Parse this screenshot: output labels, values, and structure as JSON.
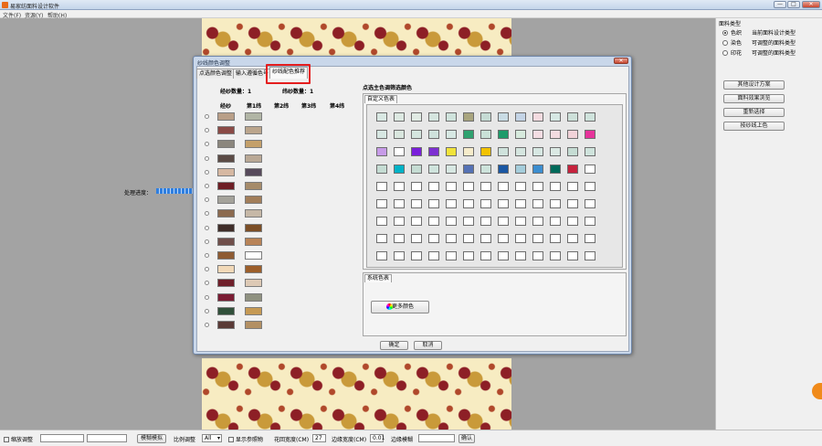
{
  "window": {
    "title": "易家纺面料设计软件",
    "controls": [
      "—",
      "□",
      "✕"
    ]
  },
  "menu": [
    "文件(F)",
    "资源(Y)",
    "帮助(H)"
  ],
  "progress": {
    "label": "处理进度：",
    "fraction": 0.95
  },
  "right_panel": {
    "group_title": "面料类型",
    "options": [
      {
        "name": "色织",
        "desc": "当前面料设计类型",
        "checked": true
      },
      {
        "name": "染色",
        "desc": "可调整的面料类型",
        "checked": false
      },
      {
        "name": "印花",
        "desc": "可调整的面料类型",
        "checked": false
      }
    ],
    "buttons": [
      "其他设计方案",
      "面料效果浏览",
      "重新选择",
      "按纱线上色"
    ]
  },
  "bottom_bar": {
    "zoom_adjust": "缩放调整",
    "blur_button": "模糊模拟",
    "ratio_label": "比例调整",
    "ratio_value": "All",
    "show_ref": "显示参照物",
    "repeat_width_label": "花回宽度(CM)",
    "repeat_width_value": "27",
    "edge_width_label": "边缘宽度(CM)",
    "edge_width_value": "0.01",
    "edge_blur_label": "边缘模糊",
    "confirm": "确认"
  },
  "dialog": {
    "title": "纱线颜色调整",
    "close": "✕",
    "tabs": [
      "点选颜色调整",
      "输入遵循色号",
      "纱线配色推荐"
    ],
    "active_tab": 2,
    "warp_count_label": "经纱数量：1",
    "weft_count_label": "纬纱数量：1",
    "columns": [
      "经纱",
      "第1纬",
      "第2纬",
      "第3纬",
      "第4纬"
    ],
    "rows": [
      [
        "#b99f88",
        "#b1b5a5"
      ],
      [
        "#8a4a46",
        "#bba58c"
      ],
      [
        "#8b867d",
        "#c4a06a"
      ],
      [
        "#5b4b46",
        "#b9a895"
      ],
      [
        "#d6b8a2",
        "#574a5b"
      ],
      [
        "#6e1e25",
        "#a68b6a"
      ],
      [
        "#a4a29a",
        "#a27e5a"
      ],
      [
        "#8b6a4f",
        "#c6b8a7"
      ],
      [
        "#3f2d29",
        "#7b4e26"
      ],
      [
        "#704f4b",
        "#b88357"
      ],
      [
        "#8e5b33",
        "#ffffff"
      ],
      [
        "#f2d9b8",
        "#9c5e2a"
      ],
      [
        "#6f1f2a",
        "#ddc9b5"
      ],
      [
        "#7a1c33",
        "#8f9180"
      ],
      [
        "#31503a",
        "#c69a54"
      ],
      [
        "#5a3a36",
        "#b39063"
      ]
    ],
    "color_section_title": "点选主色调筛选颜色",
    "custom_tab": "自定义色表",
    "palette": [
      [
        "#d9e8e3",
        "#dde9e2",
        "#e1ebe4",
        "#d5e5df",
        "#cfe3dc",
        "#a9a57e",
        "#c5dbd4",
        "#c9dce5",
        "#c4d4e6",
        "#f3dbe0",
        "#d6e8e4",
        "#cde0d9",
        "#cfe3dc"
      ],
      [
        "#d7e7e2",
        "#d9e6de",
        "#d5e6df",
        "#cfe2dc",
        "#d7e8e3",
        "#2fa26f",
        "#c9e1d7",
        "#1e9b6a",
        "#d7eadd",
        "#f4dde3",
        "#f3dbe0",
        "#f1d2d8",
        "#e6339b"
      ],
      [
        "#c79be8",
        "#ffffff",
        "#7a1fdb",
        "#7d2fd1",
        "#f1e33a",
        "#f6eccb",
        "#f2c200",
        "#cfe2dc",
        "#d5e5df",
        "#d7e7e2",
        "#dbe9e3",
        "#c5dcd3",
        "#cfe3dc"
      ],
      [
        "#c5dcd3",
        "#00b3c7",
        "#c5dcd3",
        "#cfe3dc",
        "#d7e7e2",
        "#5572b5",
        "#cde3db",
        "#1a57a3",
        "#a5cddb",
        "#3c8ed0",
        "#006a5a",
        "#c6223d",
        "#ffffff"
      ],
      [
        "#ffffff",
        "#ffffff",
        "#ffffff",
        "#ffffff",
        "#ffffff",
        "#ffffff",
        "#ffffff",
        "#ffffff",
        "#ffffff",
        "#ffffff",
        "#ffffff",
        "#ffffff",
        "#ffffff"
      ],
      [
        "#ffffff",
        "#ffffff",
        "#ffffff",
        "#ffffff",
        "#ffffff",
        "#ffffff",
        "#ffffff",
        "#ffffff",
        "#ffffff",
        "#ffffff",
        "#ffffff",
        "#ffffff",
        "#ffffff"
      ],
      [
        "#ffffff",
        "#ffffff",
        "#ffffff",
        "#ffffff",
        "#ffffff",
        "#ffffff",
        "#ffffff",
        "#ffffff",
        "#ffffff",
        "#ffffff",
        "#ffffff",
        "#ffffff",
        "#ffffff"
      ],
      [
        "#ffffff",
        "#ffffff",
        "#ffffff",
        "#ffffff",
        "#ffffff",
        "#ffffff",
        "#ffffff",
        "#ffffff",
        "#ffffff",
        "#ffffff",
        "#ffffff",
        "#ffffff",
        "#ffffff"
      ],
      [
        "#ffffff",
        "#ffffff",
        "#ffffff",
        "#ffffff",
        "#ffffff",
        "#ffffff",
        "#ffffff",
        "#ffffff",
        "#ffffff",
        "#ffffff",
        "#ffffff",
        "#ffffff",
        "#ffffff"
      ]
    ],
    "system_tab": "系统色表",
    "more_colors": "更多颜色",
    "ok": "确定",
    "cancel": "取消"
  },
  "colors": {
    "highlight": "#e41d1d",
    "progress": "#2f7fe0",
    "scroll_handle": "#f08a1a"
  }
}
